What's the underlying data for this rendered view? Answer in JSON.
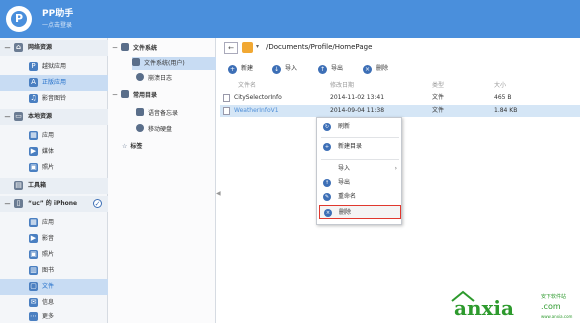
{
  "app": {
    "title": "PP助手",
    "subtitle": "一点击登录",
    "logo_letter": "P"
  },
  "sidebar": {
    "groups": [
      {
        "toggle": "－",
        "icon": "home-icon",
        "label": "网络资源",
        "items": [
          {
            "icon": "pp-icon",
            "label": "越狱应用"
          },
          {
            "icon": "store-icon",
            "label": "正版应用"
          },
          {
            "icon": "music-icon",
            "label": "影音图铃"
          }
        ]
      },
      {
        "toggle": "－",
        "icon": "monitor-icon",
        "label": "本地资源",
        "items": [
          {
            "icon": "apps-icon",
            "label": "应用"
          },
          {
            "icon": "media-icon",
            "label": "媒体"
          },
          {
            "icon": "photo-icon",
            "label": "照片"
          }
        ]
      }
    ],
    "toolbox_label": "工具箱",
    "device": {
      "toggle": "－",
      "label": "“uc” 的 iPhone",
      "items": [
        {
          "icon": "apps-icon",
          "label": "应用"
        },
        {
          "icon": "video-icon",
          "label": "影音"
        },
        {
          "icon": "photo-icon",
          "label": "照片"
        },
        {
          "icon": "book-icon",
          "label": "图书"
        },
        {
          "icon": "file-icon",
          "label": "文件"
        },
        {
          "icon": "message-icon",
          "label": "信息"
        },
        {
          "icon": "more-icon",
          "label": "更多"
        }
      ]
    }
  },
  "tree": {
    "filesystem_label": "文件系统",
    "filesystem_user": "文件系统(用户)",
    "crash_log": "崩溃日志",
    "common_dirs": "常用目录",
    "voice_memo": "语音备忘录",
    "mobile_disk": "移动硬盘",
    "bookmarks": "标签"
  },
  "address": {
    "back": "←",
    "caret": "▾",
    "path": "/Documents/Profile/HomePage"
  },
  "toolbar": {
    "new": "新建",
    "import": "导入",
    "export": "导出",
    "delete": "删除"
  },
  "table": {
    "headers": [
      "文件名",
      "修改日期",
      "类型",
      "大小"
    ],
    "rows": [
      {
        "name": "CitySelectorInfo",
        "date": "2014-11-02 13:41",
        "type": "文件",
        "size": "465 B"
      },
      {
        "name": "WeatherInfoV1",
        "date": "2014-09-04 11:38",
        "type": "文件",
        "size": "1.84 KB"
      }
    ]
  },
  "context_menu": {
    "refresh": "刷新",
    "new_dir": "新建目录",
    "import": "导入",
    "export": "导出",
    "rename": "重命名",
    "delete": "删除"
  },
  "watermark": {
    "brand": "anxia",
    "tld": ".com",
    "cn": "安下软件站",
    "en": "www.anxia.com"
  },
  "colors": {
    "titlebar": "#4a8fdc",
    "selection": "#c8dcf3",
    "watermark": "#2d9a2d",
    "delete_outline": "#e0382e"
  }
}
